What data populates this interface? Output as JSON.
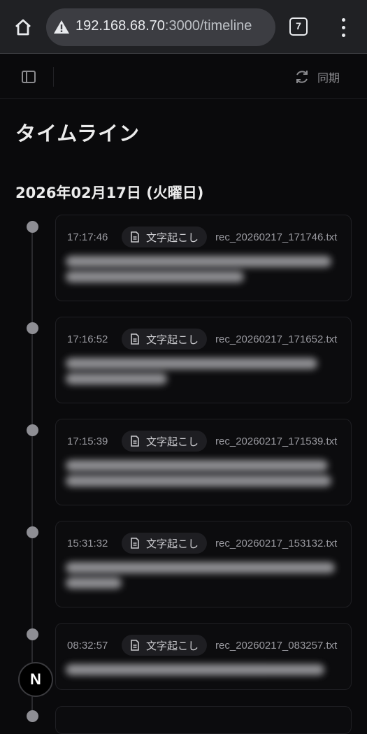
{
  "browser": {
    "url_host": "192.168.68.70",
    "url_path": ":3000/timeline",
    "tab_count": "7"
  },
  "toolbar": {
    "sync_label": "同期"
  },
  "page": {
    "title": "タイムライン",
    "date_heading": "2026年02月17日 (火曜日)"
  },
  "entries": [
    {
      "time": "17:17:46",
      "badge": "文字起こし",
      "file": "rec_20260217_171746.txt"
    },
    {
      "time": "17:16:52",
      "badge": "文字起こし",
      "file": "rec_20260217_171652.txt"
    },
    {
      "time": "17:15:39",
      "badge": "文字起こし",
      "file": "rec_20260217_171539.txt"
    },
    {
      "time": "15:31:32",
      "badge": "文字起こし",
      "file": "rec_20260217_153132.txt"
    },
    {
      "time": "08:32:57",
      "badge": "文字起こし",
      "file": "rec_20260217_083257.txt"
    }
  ],
  "dev_badge": "N",
  "colors": {
    "background": "#0a0a0c",
    "browser_chrome": "#202124",
    "timeline_dot": "#8e8e94"
  }
}
